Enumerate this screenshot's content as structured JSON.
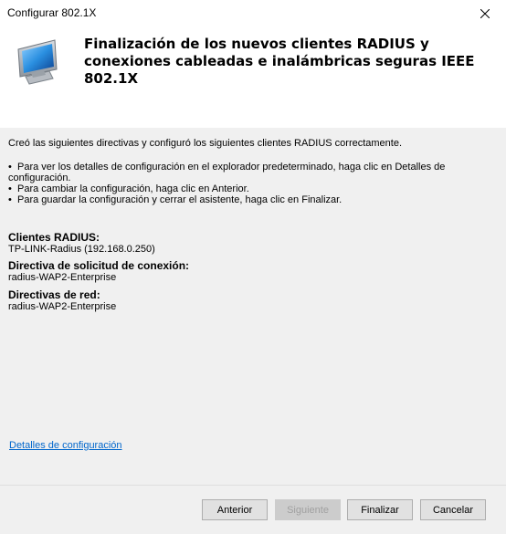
{
  "window": {
    "title": "Configurar 802.1X"
  },
  "header": {
    "heading": "Finalización de los nuevos clientes RADIUS y conexiones cableadas e inalámbricas seguras IEEE 802.1X",
    "icon": "computer-monitor-icon"
  },
  "content": {
    "intro": "Creó las siguientes directivas y configuró los siguientes clientes RADIUS correctamente.",
    "bullets": [
      "Para ver los detalles de configuración en el explorador predeterminado, haga clic en Detalles de configuración.",
      "Para cambiar la configuración, haga clic en Anterior.",
      "Para guardar la configuración y cerrar el asistente, haga clic en Finalizar."
    ],
    "sections": [
      {
        "label": "Clientes RADIUS:",
        "value": "TP-LINK-Radius (192.168.0.250)"
      },
      {
        "label": "Directiva de solicitud de conexión:",
        "value": "radius-WAP2-Enterprise"
      },
      {
        "label": "Directivas de red:",
        "value": "radius-WAP2-Enterprise"
      }
    ],
    "details_link": "Detalles de configuración"
  },
  "buttons": {
    "back": "Anterior",
    "next": "Siguiente",
    "finish": "Finalizar",
    "cancel": "Cancelar"
  },
  "colors": {
    "link": "#0066cc",
    "dialog_bg": "#f0f0f0",
    "header_bg": "#ffffff"
  }
}
